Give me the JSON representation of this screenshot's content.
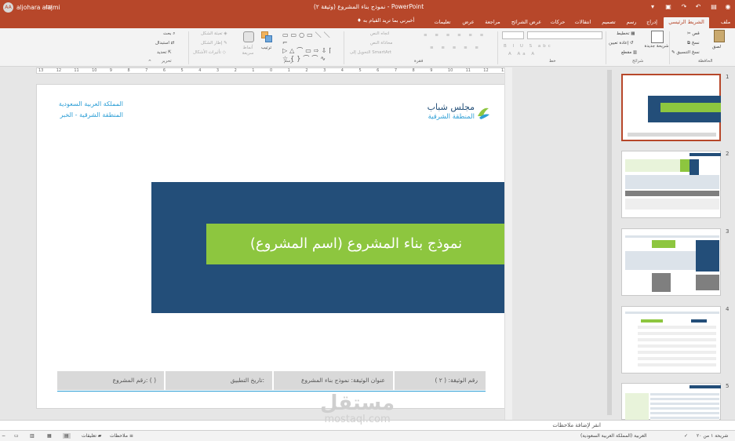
{
  "window": {
    "title": "نموذج بناء المشروع (وثيقة ٢) - PowerPoint",
    "user_name": "aljohara alajmi",
    "user_initials": "AA"
  },
  "tabs": [
    {
      "label": "ملف"
    },
    {
      "label": "الشريط الرئيسي",
      "active": true
    },
    {
      "label": "إدراج"
    },
    {
      "label": "رسم"
    },
    {
      "label": "تصميم"
    },
    {
      "label": "انتقالات"
    },
    {
      "label": "حركات"
    },
    {
      "label": "عرض الشرائح"
    },
    {
      "label": "مراجعة"
    },
    {
      "label": "عرض"
    },
    {
      "label": "تعليمات"
    }
  ],
  "tell_me": "أخبرني بما تريد القيام به",
  "ribbon": {
    "clipboard": {
      "label": "الحافظة",
      "paste": "لصق",
      "cut": "قص",
      "copy": "نسخ",
      "format_painter": "نسخ التنسيق"
    },
    "slides": {
      "label": "شرائح",
      "new_slide": "شريحة جديدة",
      "layout": "تخطيط",
      "reset": "إعادة تعيين",
      "section": "مقطع"
    },
    "font": {
      "label": "خط"
    },
    "paragraph": {
      "label": "فقرة",
      "text_direction": "اتجاه النص",
      "align_text": "محاذاة النص",
      "smartart": "التحويل إلى SmartArt"
    },
    "drawing": {
      "label": "رسم",
      "arrange": "ترتيب",
      "quick_styles": "أنماط سريعة",
      "shape_fill": "تعبئة الشكل",
      "shape_outline": "إطار الشكل",
      "shape_effects": "تأثيرات الأشكال"
    },
    "editing": {
      "label": "تحرير",
      "find": "بحث",
      "replace": "استبدال",
      "select": "تحديد"
    }
  },
  "ruler": {
    "numbers": [
      "13",
      "12",
      "11",
      "10",
      "9",
      "8",
      "7",
      "6",
      "5",
      "4",
      "3",
      "2",
      "1",
      "0",
      "1",
      "2",
      "3",
      "4",
      "5",
      "6",
      "7",
      "8",
      "9",
      "10",
      "11",
      "12",
      "13"
    ]
  },
  "slide": {
    "org_line1": "المملكة العربية السعودية",
    "org_line2": "المنطقة الشرقية - الخبر",
    "logo_line1": "مجلس شباب",
    "logo_line2": "المنطقة الشرقية",
    "title": "نموذج بناء المشروع (اسم المشروع)",
    "footer": {
      "doc_number": "رقم الوثيقة: ( ٢ )",
      "doc_title": "عنوان الوثيقة: نموذج بناء المشروع",
      "apply_date": "تاريخ التطبيق:",
      "project_number": "رقم المشروع: (   )"
    },
    "colors": {
      "navy": "#234e79",
      "green": "#8dc63f",
      "footer_gray": "#d9d9d9",
      "accent_blue": "#2e9fd6"
    }
  },
  "thumbnails": [
    {
      "number": "1",
      "selected": true
    },
    {
      "number": "2",
      "selected": false
    },
    {
      "number": "3",
      "selected": false
    },
    {
      "number": "4",
      "selected": false
    },
    {
      "number": "5",
      "selected": false
    }
  ],
  "notes_placeholder": "انقر لإضافة ملاحظات",
  "status": {
    "slide_of": "شريحة ١ من ٢٠",
    "language": "العربية (المملكة العربية السعودية)",
    "notes": "ملاحظات",
    "comments": "تعليقات"
  },
  "watermark": {
    "line1": "مستقل",
    "line2": "mostaql.com"
  }
}
